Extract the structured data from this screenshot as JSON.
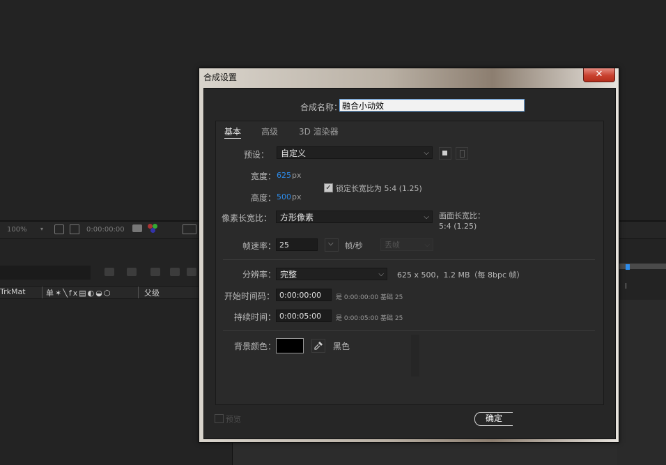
{
  "background": {
    "zoom": "100%",
    "timecode": "0:00:00:00",
    "col_trkmat": "TrkMat",
    "col_switches": "单✶╲fx▤◐◒⬡",
    "col_parent": "父级"
  },
  "dialog": {
    "title": "合成设置",
    "close_symbol": "✕",
    "name_label": "合成名称：",
    "name_value": "融合小动效",
    "tabs": [
      {
        "label": "基本"
      },
      {
        "label": "高级"
      },
      {
        "label": "3D 渲染器"
      }
    ],
    "preset_label": "预设：",
    "preset_value": "自定义",
    "width_label": "宽度：",
    "width_value": "625",
    "height_label": "高度：",
    "height_value": "500",
    "px_unit": "px",
    "lock_label": "锁定长宽比为 5:4 (1.25)",
    "lock_checked": true,
    "pixel_aspect_label": "像素长宽比：",
    "pixel_aspect_value": "方形像素",
    "frame_aspect_label": "画面长宽比：",
    "frame_aspect_value": "5:4 (1.25)",
    "fps_label": "帧速率：",
    "fps_value": "25",
    "fps_unit": "帧/秒",
    "fps_drop": "丢帧",
    "resolution_label": "分辨率：",
    "resolution_value": "完整",
    "resolution_info": "625 x 500，1.2 MB（每 8bpc 帧）",
    "start_label": "开始时间码：",
    "start_value": "0:00:00:00",
    "start_info": "是 0:00:00:00",
    "start_base": "基础 25",
    "duration_label": "持续时间：",
    "duration_value": "0:00:05:00",
    "duration_info": "是 0:00:05:00",
    "duration_base": "基础 25",
    "bg_color_label": "背景颜色：",
    "bg_color_name": "黑色",
    "bg_color_hex": "#000000",
    "preview_label": "预览",
    "ok_label": "确定"
  },
  "colors": {
    "accent_blue": "#2d8ceb",
    "close_red": "#c8412f"
  }
}
